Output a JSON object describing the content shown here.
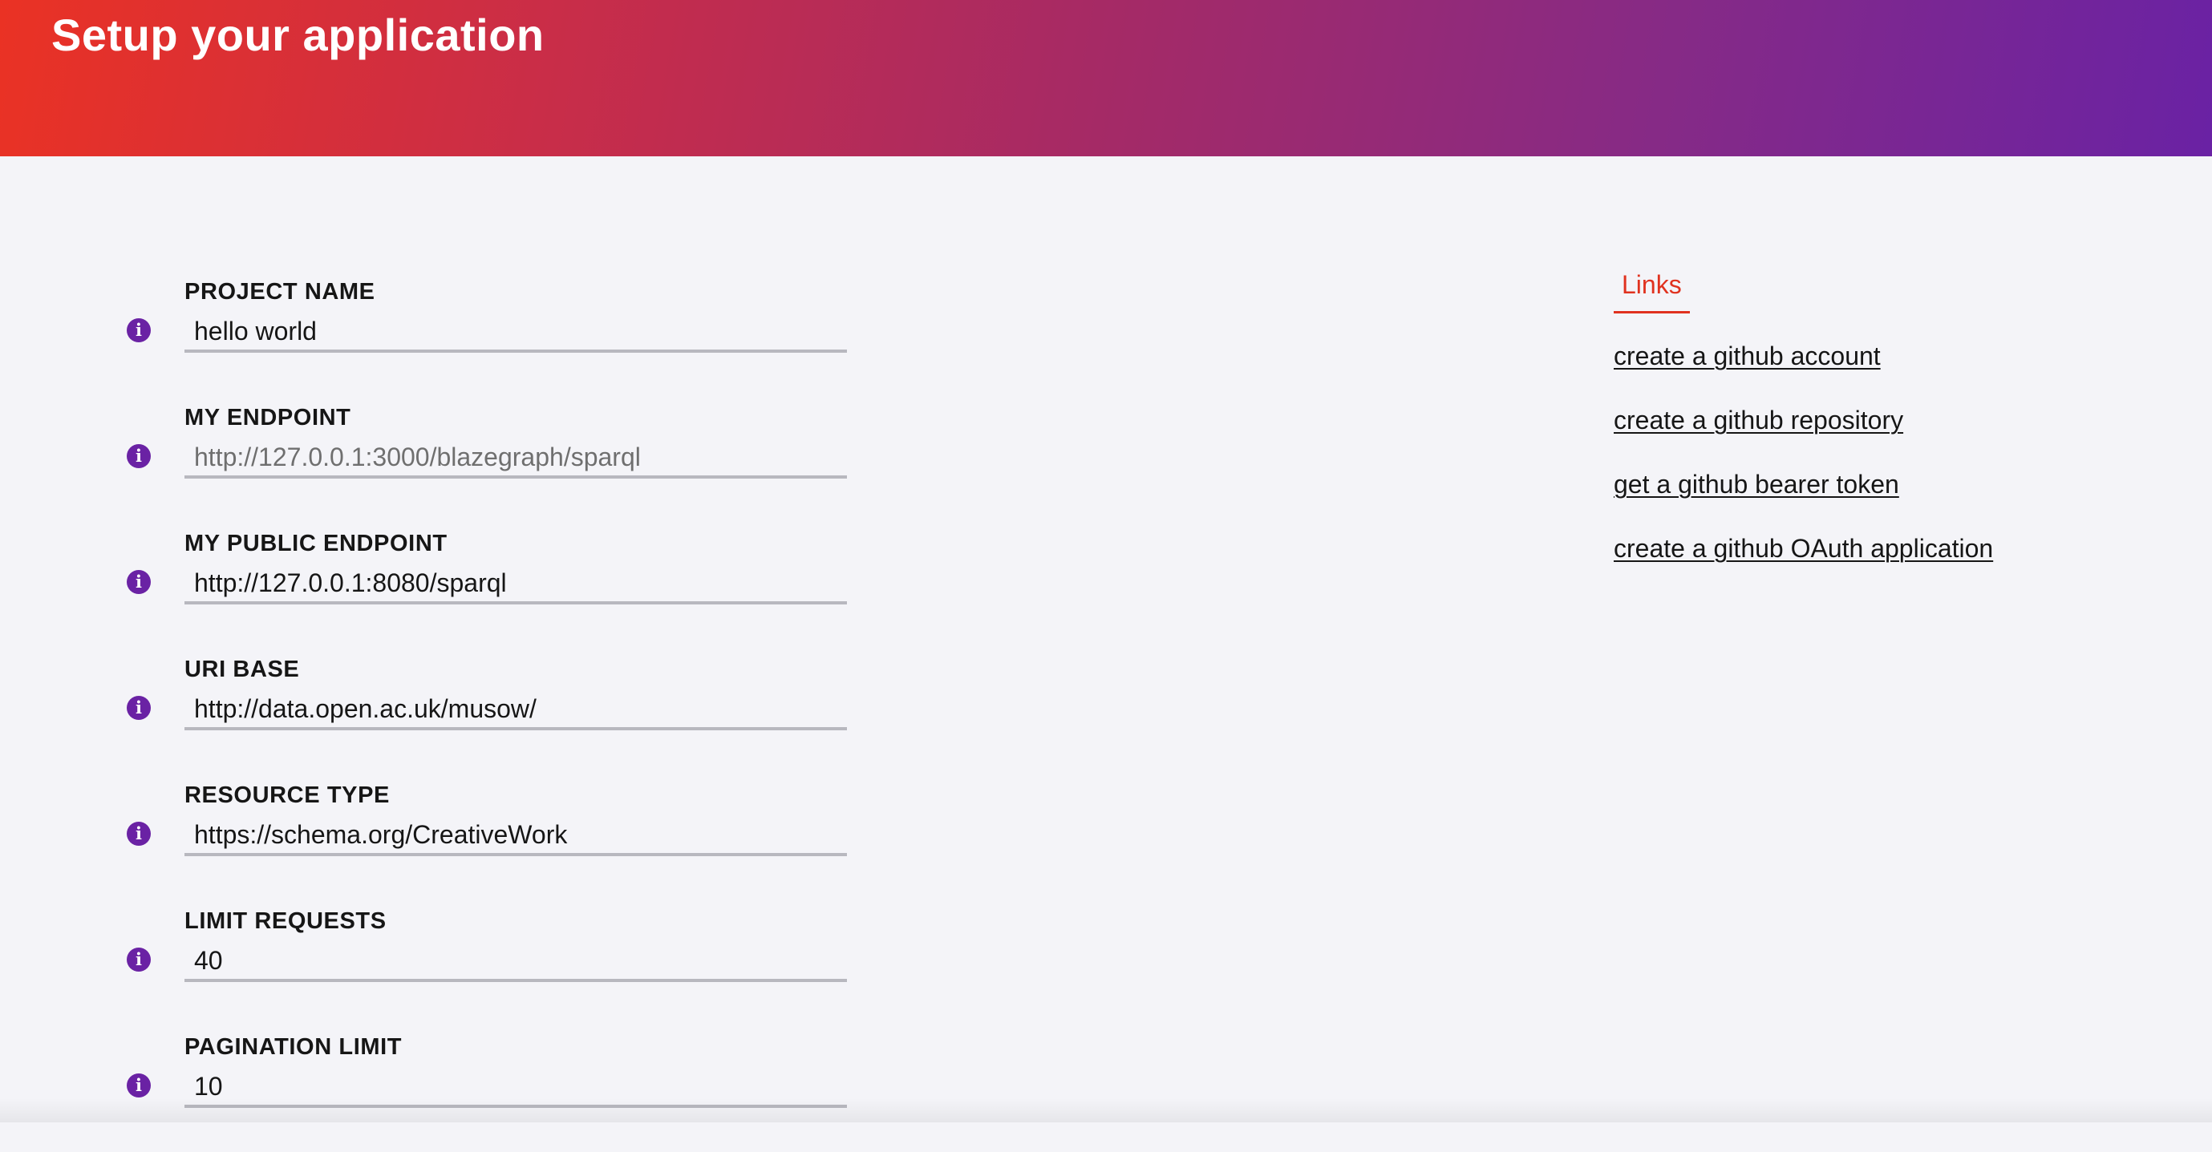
{
  "header": {
    "title": "Setup your application",
    "gradient_start": "#ea3224",
    "gradient_end": "#6a22a4"
  },
  "form": {
    "fields": [
      {
        "label": "PROJECT NAME",
        "value": "hello world",
        "placeholder": "",
        "icon": "info-icon"
      },
      {
        "label": "MY ENDPOINT",
        "value": "",
        "placeholder": "http://127.0.0.1:3000/blazegraph/sparql",
        "icon": "info-icon"
      },
      {
        "label": "MY PUBLIC ENDPOINT",
        "value": "http://127.0.0.1:8080/sparql",
        "placeholder": "",
        "icon": "info-icon"
      },
      {
        "label": "URI BASE",
        "value": "http://data.open.ac.uk/musow/",
        "placeholder": "",
        "icon": "info-icon"
      },
      {
        "label": "RESOURCE TYPE",
        "value": "https://schema.org/CreativeWork",
        "placeholder": "",
        "icon": "info-icon"
      },
      {
        "label": "LIMIT REQUESTS",
        "value": "40",
        "placeholder": "",
        "icon": "info-icon"
      },
      {
        "label": "PAGINATION LIMIT",
        "value": "10",
        "placeholder": "",
        "icon": "info-icon"
      }
    ]
  },
  "links": {
    "tab_label": "Links",
    "accent_color": "#e0321f",
    "items": [
      {
        "label": "create a github account"
      },
      {
        "label": "create a github repository"
      },
      {
        "label": "get a github bearer token"
      },
      {
        "label": "create a github OAuth application"
      }
    ]
  },
  "icon_color": "#6a22a4"
}
